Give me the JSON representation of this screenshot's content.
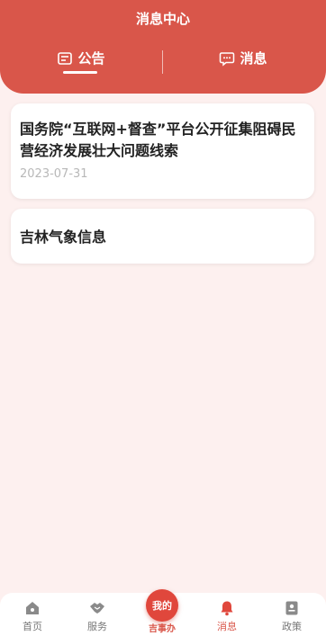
{
  "header": {
    "title": "消息中心",
    "tabs": [
      {
        "label": "公告",
        "icon": "notice-icon",
        "active": true
      },
      {
        "label": "消息",
        "icon": "chat-icon",
        "active": false
      }
    ]
  },
  "cards": [
    {
      "title": "国务院“互联网+督查”平台公开征集阻碍民营经济发展壮大问题线索",
      "date": "2023-07-31"
    },
    {
      "title": "吉林气象信息"
    }
  ],
  "tabbar": {
    "items": [
      {
        "label": "首页",
        "icon": "home-icon"
      },
      {
        "label": "服务",
        "icon": "handshake-icon"
      },
      {
        "label": "消息",
        "icon": "bell-icon",
        "active": true
      },
      {
        "label": "政策",
        "icon": "policy-icon"
      }
    ],
    "center": {
      "badge": "我的",
      "label": "吉事办"
    }
  },
  "colors": {
    "primary": "#d9564a",
    "background": "#fdf0ef"
  }
}
